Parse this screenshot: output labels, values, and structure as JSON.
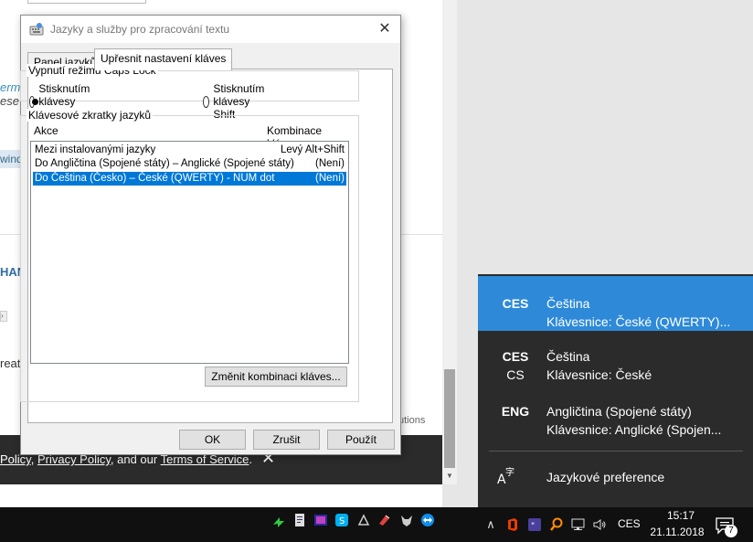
{
  "background_page": {
    "frag_germ": "erma",
    "frag_ese": "ese j",
    "frag_wind": "wind",
    "frag_han": "HAN",
    "frag_reat": "reat",
    "frag_utions": "utions",
    "cookie_policy": "Policy",
    "cookie_sep1": ", ",
    "cookie_privacy": "Privacy Policy",
    "cookie_and": ", and our ",
    "cookie_terms": "Terms of Service",
    "cookie_end": "."
  },
  "dialog": {
    "title": "Jazyky a služby pro zpracování textu",
    "tabs": [
      {
        "label": "Panel jazyků"
      },
      {
        "label": "Upřesnit nastavení kláves"
      }
    ],
    "caps_group": {
      "label": "Vypnutí režimu Caps Lock",
      "option_caps": "Stisknutím klávesy Caps Lock",
      "option_shift": "Stisknutím klávesy Shift",
      "selected": "caps"
    },
    "hotkeys_group": {
      "label": "Klávesové zkratky jazyků",
      "col_action": "Akce",
      "col_combo": "Kombinace kláves",
      "rows": [
        {
          "action": "Mezi instalovanými jazyky",
          "combo": "Levý Alt+Shift"
        },
        {
          "action": "Do Angličtina (Spojené státy) – Anglické (Spojené státy)",
          "combo": "(Není)"
        },
        {
          "action": "Do Čeština (Česko) – České (QWERTY) - NUM dot",
          "combo": "(Není)"
        }
      ],
      "change_button": "Změnit kombinaci kláves..."
    },
    "ok_button": "OK",
    "cancel_button": "Zrušit",
    "apply_button": "Použít"
  },
  "language_flyout": {
    "items": [
      {
        "code": "CES",
        "sub": "",
        "name": "Čeština",
        "keyboard": "Klávesnice: České (QWERTY)..."
      },
      {
        "code": "CES",
        "sub": "CS",
        "name": "Čeština",
        "keyboard": "Klávesnice: České"
      },
      {
        "code": "ENG",
        "sub": "",
        "name": "Angličtina (Spojené státy)",
        "keyboard": "Klávesnice: Anglické (Spojen..."
      }
    ],
    "preferences_label": "Jazykové preference"
  },
  "taskbar": {
    "tray_language": "CES",
    "time": "15:17",
    "date": "21.11.2018",
    "notification_count": "7"
  },
  "colors": {
    "selection_blue": "#0078d7",
    "flyout_active": "#2e8ad8",
    "flyout_bg": "#2b2b2b",
    "taskbar_bg": "#101010"
  }
}
